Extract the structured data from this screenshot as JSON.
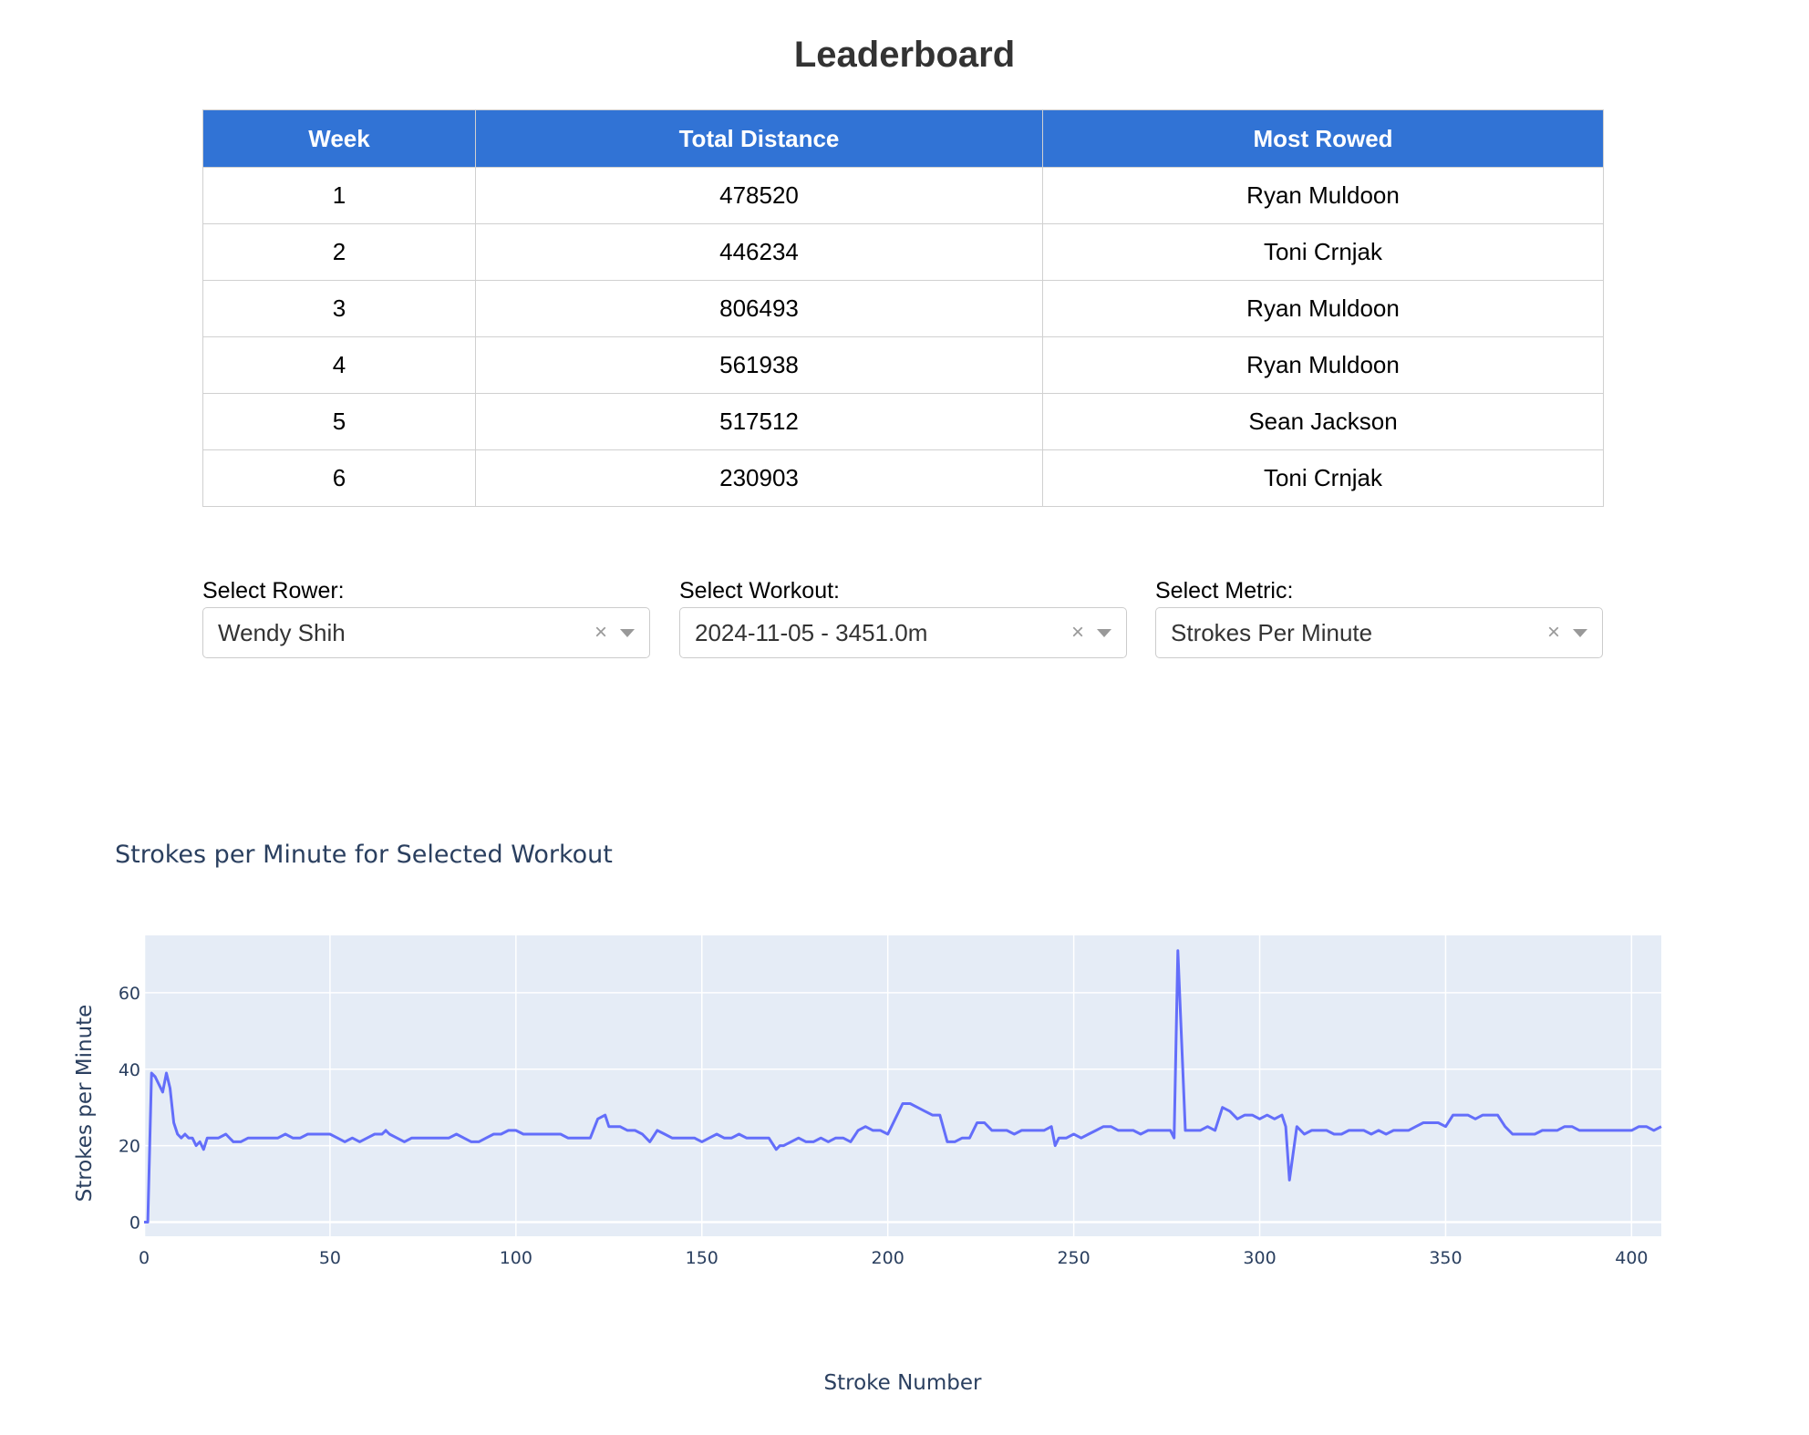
{
  "page": {
    "title": "Leaderboard"
  },
  "table": {
    "headers": [
      "Week",
      "Total Distance",
      "Most Rowed"
    ],
    "rows": [
      [
        "1",
        "478520",
        "Ryan Muldoon"
      ],
      [
        "2",
        "446234",
        "Toni Crnjak"
      ],
      [
        "3",
        "806493",
        "Ryan Muldoon"
      ],
      [
        "4",
        "561938",
        "Ryan Muldoon"
      ],
      [
        "5",
        "517512",
        "Sean Jackson"
      ],
      [
        "6",
        "230903",
        "Toni Crnjak"
      ]
    ]
  },
  "controls": {
    "rower": {
      "label": "Select Rower:",
      "value": "Wendy Shih"
    },
    "workout": {
      "label": "Select Workout:",
      "value": "2024-11-05 - 3451.0m"
    },
    "metric": {
      "label": "Select Metric:",
      "value": "Strokes Per Minute"
    },
    "clear_glyph": "×"
  },
  "chart_data": {
    "type": "line",
    "title": "Strokes per Minute for Selected Workout",
    "xlabel": "Stroke Number",
    "ylabel": "Strokes per Minute",
    "xlim": [
      0,
      408
    ],
    "ylim": [
      -3.7,
      75
    ],
    "xticks": [
      0,
      50,
      100,
      150,
      200,
      250,
      300,
      350,
      400
    ],
    "yticks": [
      0,
      20,
      40,
      60
    ],
    "grid": true,
    "colors": {
      "line": "#636efa",
      "plot_bg": "#e5ecf6",
      "grid": "#ffffff",
      "text": "#2a3f5f"
    },
    "x": [
      0,
      1,
      2,
      3,
      4,
      5,
      6,
      7,
      8,
      9,
      10,
      11,
      12,
      13,
      14,
      15,
      16,
      17,
      18,
      19,
      20,
      22,
      24,
      26,
      28,
      30,
      32,
      34,
      36,
      38,
      40,
      42,
      44,
      46,
      48,
      50,
      52,
      54,
      56,
      58,
      60,
      62,
      64,
      65,
      66,
      68,
      70,
      72,
      74,
      76,
      78,
      80,
      82,
      84,
      86,
      88,
      90,
      92,
      94,
      96,
      98,
      100,
      102,
      104,
      106,
      108,
      110,
      112,
      114,
      116,
      118,
      120,
      122,
      124,
      125,
      126,
      127,
      128,
      130,
      132,
      134,
      136,
      138,
      140,
      142,
      144,
      146,
      148,
      150,
      152,
      154,
      156,
      158,
      160,
      162,
      164,
      166,
      168,
      170,
      171,
      172,
      174,
      176,
      178,
      180,
      182,
      184,
      186,
      188,
      190,
      192,
      194,
      196,
      198,
      200,
      202,
      204,
      206,
      208,
      210,
      212,
      214,
      216,
      218,
      220,
      222,
      224,
      226,
      228,
      230,
      232,
      234,
      236,
      238,
      240,
      242,
      244,
      245,
      246,
      248,
      250,
      252,
      254,
      256,
      258,
      260,
      262,
      264,
      266,
      268,
      270,
      272,
      274,
      276,
      277,
      278,
      280,
      282,
      284,
      286,
      288,
      290,
      292,
      294,
      296,
      298,
      300,
      302,
      304,
      306,
      307,
      308,
      310,
      312,
      314,
      316,
      318,
      320,
      322,
      324,
      326,
      328,
      330,
      332,
      334,
      336,
      338,
      340,
      342,
      344,
      346,
      348,
      350,
      352,
      354,
      356,
      358,
      360,
      362,
      364,
      366,
      368,
      370,
      372,
      374,
      376,
      378,
      380,
      382,
      384,
      386,
      388,
      390,
      392,
      394,
      396,
      398,
      400,
      402,
      404,
      406,
      408
    ],
    "y": [
      0,
      0,
      39,
      38,
      36,
      34,
      39,
      35,
      26,
      23,
      22,
      23,
      22,
      22,
      20,
      21,
      19,
      22,
      22,
      22,
      22,
      23,
      21,
      21,
      22,
      22,
      22,
      22,
      22,
      23,
      22,
      22,
      23,
      23,
      23,
      23,
      22,
      21,
      22,
      21,
      22,
      23,
      23,
      24,
      23,
      22,
      21,
      22,
      22,
      22,
      22,
      22,
      22,
      23,
      22,
      21,
      21,
      22,
      23,
      23,
      24,
      24,
      23,
      23,
      23,
      23,
      23,
      23,
      22,
      22,
      22,
      22,
      27,
      28,
      25,
      25,
      25,
      25,
      24,
      24,
      23,
      21,
      24,
      23,
      22,
      22,
      22,
      22,
      21,
      22,
      23,
      22,
      22,
      23,
      22,
      22,
      22,
      22,
      19,
      20,
      20,
      21,
      22,
      21,
      21,
      22,
      21,
      22,
      22,
      21,
      24,
      25,
      24,
      24,
      23,
      27,
      31,
      31,
      30,
      29,
      28,
      28,
      21,
      21,
      22,
      22,
      26,
      26,
      24,
      24,
      24,
      23,
      24,
      24,
      24,
      24,
      25,
      20,
      22,
      22,
      23,
      22,
      23,
      24,
      25,
      25,
      24,
      24,
      24,
      23,
      24,
      24,
      24,
      24,
      22,
      71,
      24,
      24,
      24,
      25,
      24,
      30,
      29,
      27,
      28,
      28,
      27,
      28,
      27,
      28,
      25,
      11,
      25,
      23,
      24,
      24,
      24,
      23,
      23,
      24,
      24,
      24,
      23,
      24,
      23,
      24,
      24,
      24,
      25,
      26,
      26,
      26,
      25,
      28,
      28,
      28,
      27,
      28,
      28,
      28,
      25,
      23,
      23,
      23,
      23,
      24,
      24,
      24,
      25,
      25,
      24,
      24,
      24,
      24,
      24,
      24,
      24,
      24,
      25,
      25,
      24,
      25,
      24,
      23
    ]
  }
}
